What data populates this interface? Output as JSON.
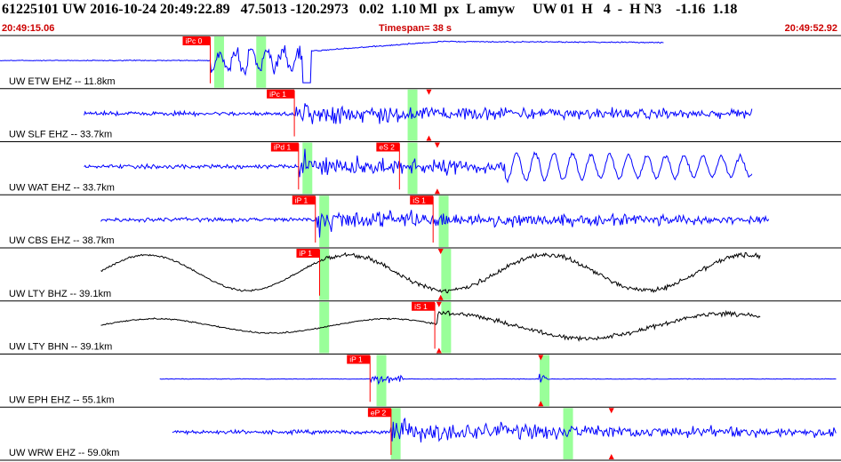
{
  "header": {
    "title": "61225101 UW 2016-10-24 20:49:22.89   47.5013 -120.2973   0.02  1.10 Ml  px  L amyw     UW 01  H   4  -  H N3    -1.16  1.18",
    "time_start": "20:49:15.06",
    "timespan": "Timespan=  38 s",
    "time_end": "20:49:52.92"
  },
  "colors": {
    "trace_blue": "#0000ff",
    "trace_black": "#000000",
    "pick_red": "#ff0000",
    "window_green": "#99ff99",
    "header_red": "#cc0000",
    "grid": "#888888"
  },
  "channels": [
    {
      "label": "UW ETW EHZ -- 11.8km",
      "color": "blue",
      "style": "step",
      "picks": [
        {
          "text": "iPc 0",
          "time": 0.25
        }
      ],
      "windows": [
        0.26,
        0.31
      ]
    },
    {
      "label": "UW SLF EHZ -- 33.7km",
      "color": "blue",
      "style": "burst",
      "picks": [
        {
          "text": "iPc 1",
          "time": 0.35
        }
      ],
      "windows": [
        0.49
      ],
      "tri_marks": [
        0.51
      ]
    },
    {
      "label": "UW WAT EHZ -- 33.7km",
      "color": "blue",
      "style": "longburst",
      "picks": [
        {
          "text": "iPd 1",
          "time": 0.355
        },
        {
          "text": "eS 2",
          "time": 0.475
        }
      ],
      "windows": [
        0.365,
        0.49
      ],
      "tri_marks": [
        0.52
      ]
    },
    {
      "label": "UW CBS EHZ -- 38.7km",
      "color": "blue",
      "style": "burst2",
      "picks": [
        {
          "text": "iP 1",
          "time": 0.375
        },
        {
          "text": "iS 1",
          "time": 0.515
        }
      ],
      "windows": [
        0.385,
        0.527
      ]
    },
    {
      "label": "UW LTY BHZ -- 39.1km",
      "color": "black",
      "style": "longperiod",
      "picks": [
        {
          "text": "iP 1",
          "time": 0.38
        }
      ],
      "windows": [
        0.385,
        0.53
      ],
      "tri_marks": [
        0.524
      ]
    },
    {
      "label": "UW LTY BHN -- 39.1km",
      "color": "black",
      "style": "longperiod2",
      "picks": [
        {
          "text": "iS 1",
          "time": 0.517
        }
      ],
      "windows": [
        0.385,
        0.53
      ],
      "tri_marks": [
        0.522
      ]
    },
    {
      "label": "UW EPH EHZ -- 55.1km",
      "color": "blue",
      "style": "quiet",
      "picks": [
        {
          "text": "iP 1",
          "time": 0.44
        }
      ],
      "windows": [
        0.453,
        0.647
      ],
      "tri_marks": [
        0.643
      ]
    },
    {
      "label": "UW WRW EHZ -- 59.0km",
      "color": "blue",
      "style": "burst3",
      "picks": [
        {
          "text": "eP 2",
          "time": 0.465
        }
      ],
      "windows": [
        0.47,
        0.675
      ],
      "tri_marks": [
        0.727
      ]
    }
  ]
}
